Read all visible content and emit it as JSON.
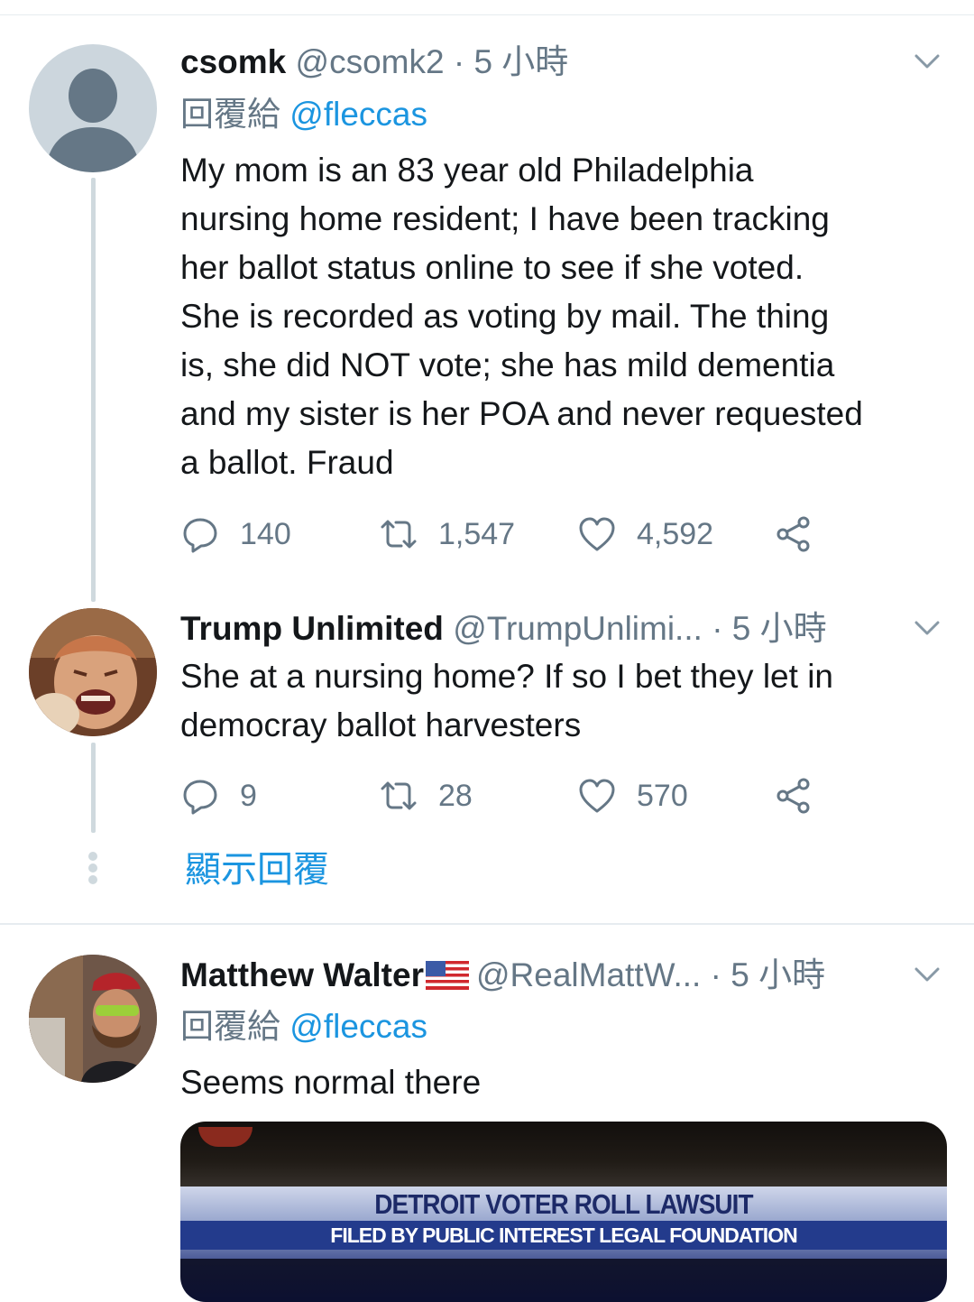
{
  "tweets": [
    {
      "name": "csomk",
      "handle": "@csomk2",
      "time": "· 5 小時",
      "reply_prefix": "回覆給",
      "reply_to": "@fleccas",
      "text_lines": [
        "My mom is an 83 year old Philadelphia",
        "nursing home resident; I have been tracking",
        "her ballot status online to see if she voted.",
        "She is recorded as voting by mail.  The thing",
        "is, she did NOT vote; she has mild dementia",
        "and my sister is her POA and never requested",
        "a ballot.  Fraud"
      ],
      "replies": "140",
      "retweets": "1,547",
      "likes": "4,592"
    },
    {
      "name": "Trump Unlimited",
      "handle": "@TrumpUnlimi...",
      "time": "· 5 小時",
      "text_lines": [
        "She at a nursing home? If so I bet they let in",
        "democray ballot harvesters"
      ],
      "replies": "9",
      "retweets": "28",
      "likes": "570"
    },
    {
      "name": "Matthew Walter",
      "handle": "@RealMattW...",
      "time": "· 5 小時",
      "reply_prefix": "回覆給",
      "reply_to": "@fleccas",
      "text": "Seems normal there",
      "media_title": "DETROIT VOTER ROLL LAWSUIT",
      "media_subtitle": "FILED BY PUBLIC INTEREST LEGAL FOUNDATION"
    }
  ],
  "show_replies": "顯示回覆",
  "colors": {
    "link": "#1b95e0",
    "secondary": "#657786",
    "text": "#14171a",
    "thread_line": "#cfd9de"
  },
  "icons": [
    "default-avatar-icon",
    "chevron-down-icon",
    "reply-icon",
    "retweet-icon",
    "like-icon",
    "share-icon",
    "us-flag-icon"
  ]
}
